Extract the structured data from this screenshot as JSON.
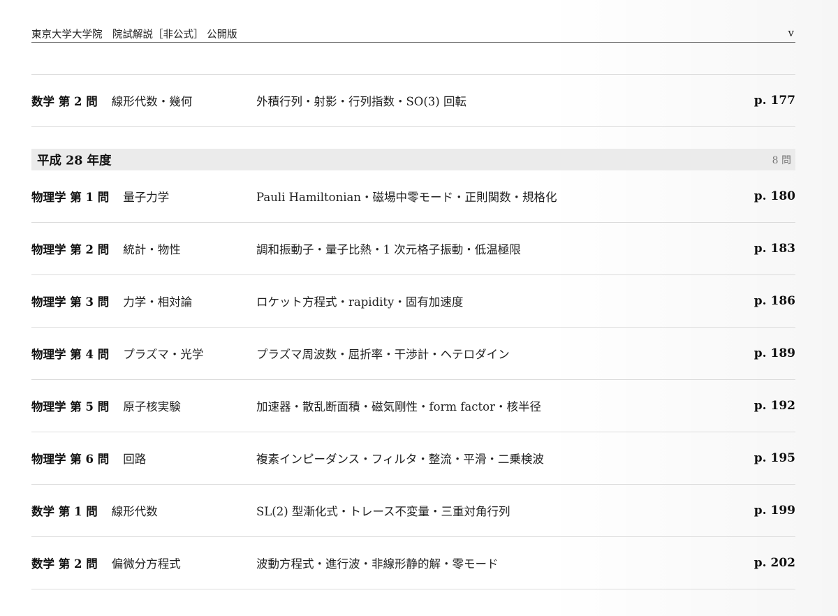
{
  "header": {
    "title": "東京大学大学院　院試解説［非公式］ 公開版",
    "page_number": "v"
  },
  "pre_entries": [
    {
      "label": "数学 第 2 問",
      "field": "線形代数・幾何",
      "topics": "外積行列・射影・行列指数・SO(3) 回転",
      "page": "p. 177"
    }
  ],
  "section": {
    "title": "平成 28 年度",
    "count": "8 問"
  },
  "entries": [
    {
      "label": "物理学 第 1 問",
      "field": "量子力学",
      "topics": "Pauli Hamiltonian・磁場中零モード・正則関数・規格化",
      "page": "p. 180"
    },
    {
      "label": "物理学 第 2 問",
      "field": "統計・物性",
      "topics": "調和振動子・量子比熱・1 次元格子振動・低温極限",
      "page": "p. 183"
    },
    {
      "label": "物理学 第 3 問",
      "field": "力学・相対論",
      "topics": "ロケット方程式・rapidity・固有加速度",
      "page": "p. 186"
    },
    {
      "label": "物理学 第 4 問",
      "field": "プラズマ・光学",
      "topics": "プラズマ周波数・屈折率・干渉計・ヘテロダイン",
      "page": "p. 189"
    },
    {
      "label": "物理学 第 5 問",
      "field": "原子核実験",
      "topics": "加速器・散乱断面積・磁気剛性・form factor・核半径",
      "page": "p. 192"
    },
    {
      "label": "物理学 第 6 問",
      "field": "回路",
      "topics": "複素インピーダンス・フィルタ・整流・平滑・二乗検波",
      "page": "p. 195"
    },
    {
      "label": "数学 第 1 問",
      "field": "線形代数",
      "topics": "SL(2) 型漸化式・トレース不変量・三重対角行列",
      "page": "p. 199"
    },
    {
      "label": "数学 第 2 問",
      "field": "偏微分方程式",
      "topics": "波動方程式・進行波・非線形静的解・零モード",
      "page": "p. 202"
    }
  ]
}
